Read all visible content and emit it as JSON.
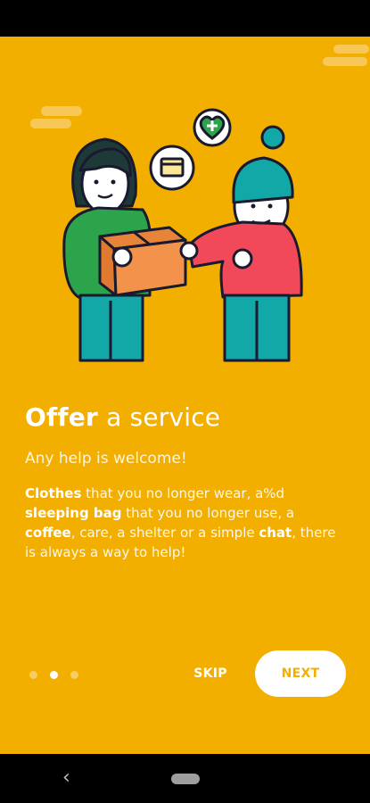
{
  "onboarding": {
    "title_bold": "Offer",
    "title_rest": " a service",
    "subtitle": "Any help is welcome!",
    "body": [
      {
        "text": "Clothes",
        "bold": true
      },
      {
        "text": " that you no longer wear, a%d ",
        "bold": false
      },
      {
        "text": "sleeping bag",
        "bold": true
      },
      {
        "text": " that you no longer use, a ",
        "bold": false
      },
      {
        "text": "coffee",
        "bold": true
      },
      {
        "text": ", care, a shelter or a simple ",
        "bold": false
      },
      {
        "text": "chat",
        "bold": true
      },
      {
        "text": ", there is always a way to help!",
        "bold": false
      }
    ],
    "pager": {
      "count": 3,
      "active_index": 1
    },
    "skip_label": "SKIP",
    "next_label": "NEXT"
  },
  "navbar": {
    "back_icon": "back-chevron-icon",
    "home_icon": "home-pill-icon"
  },
  "colors": {
    "background": "#F3AF00",
    "accent_text": "#F3AF00"
  }
}
